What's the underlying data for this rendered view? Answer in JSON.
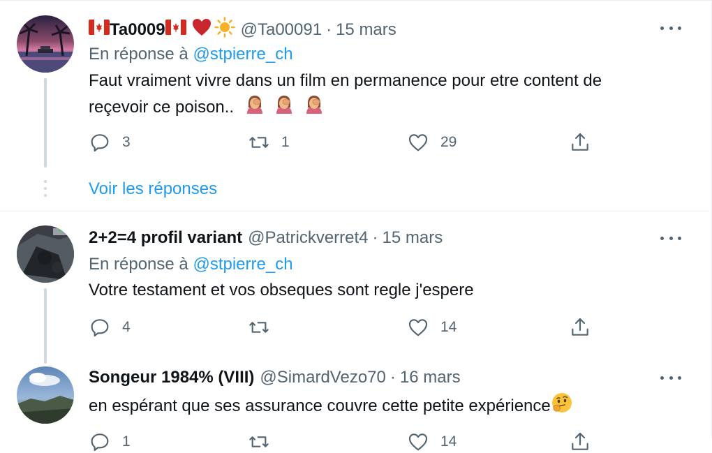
{
  "tweets": [
    {
      "name": "Ta0009",
      "handle": "@Ta00091",
      "separator": "·",
      "date": "15 mars",
      "reply_prefix": "En réponse à",
      "reply_mention": "@stpierre_ch",
      "text_line1": "Faut vraiment vivre dans un film en permanence pour etre content de",
      "text_line2": "reçevoir ce poison..",
      "replies": "3",
      "retweets": "1",
      "likes": "29",
      "show_replies": "Voir les réponses"
    },
    {
      "name": "2+2=4 profil variant",
      "handle": "@Patrickverret4",
      "separator": "·",
      "date": "15 mars",
      "reply_prefix": "En réponse à",
      "reply_mention": "@stpierre_ch",
      "text_line1": "Votre testament et vos obseques sont regle j'espere",
      "replies": "4",
      "retweets": "",
      "likes": "14"
    },
    {
      "name": "Songeur 1984% (VIII)",
      "handle": "@SimardVezo70",
      "separator": "·",
      "date": "16 mars",
      "text_line1": "en espérant que ses assurance couvre cette petite expérience",
      "replies": "1",
      "retweets": "",
      "likes": "14"
    }
  ],
  "colors": {
    "link": "#1d9bf0",
    "secondary_text": "#536471",
    "primary_text": "#0f1419",
    "divider": "#e6ecf0"
  },
  "icons": [
    "reply-icon",
    "retweet-icon",
    "like-icon",
    "share-icon",
    "more-icon",
    "canada-flag-icon",
    "heart-emoji-icon",
    "sun-emoji-icon",
    "facepalm-emoji-icon",
    "thinking-emoji-icon"
  ]
}
